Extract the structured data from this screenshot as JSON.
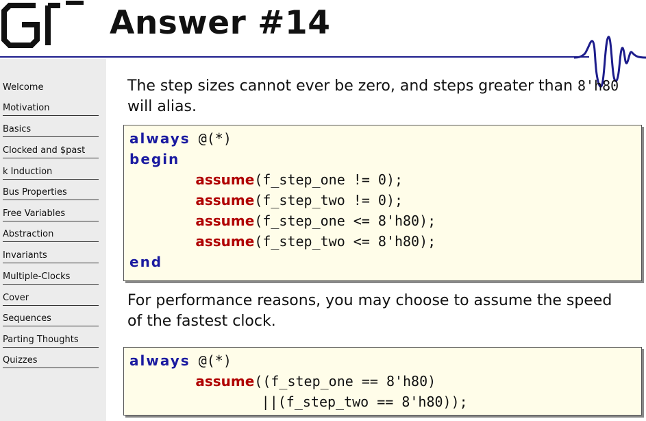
{
  "header": {
    "title": "Answer #14"
  },
  "sidebar": {
    "items": [
      {
        "label": "Welcome"
      },
      {
        "label": "Motivation"
      },
      {
        "label": "Basics"
      },
      {
        "label": "Clocked and $past"
      },
      {
        "label": "k Induction"
      },
      {
        "label": "Bus Properties"
      },
      {
        "label": "Free Variables"
      },
      {
        "label": "Abstraction"
      },
      {
        "label": "Invariants"
      },
      {
        "label": "Multiple-Clocks"
      },
      {
        "label": "Cover"
      },
      {
        "label": "Sequences"
      },
      {
        "label": "Parting Thoughts"
      },
      {
        "label": "Quizzes"
      }
    ]
  },
  "main": {
    "para1_text": "The step sizes cannot ever be zero, and steps greater than ",
    "para1_code": "8'h80",
    "para1_end": "will alias.",
    "block1": {
      "l1_kw": "always",
      "l1_rest": " @(*)",
      "l2_kw": "begin",
      "l3_fn": "assume",
      "l3_rest": "(f_step_one != 0);",
      "l4_fn": "assume",
      "l4_rest": "(f_step_two != 0);",
      "l5_fn": "assume",
      "l5_rest": "(f_step_one <= 8'h80);",
      "l6_fn": "assume",
      "l6_rest": "(f_step_two <= 8'h80);",
      "l7_kw": "end"
    },
    "para2_line1": "For performance reasons, you may choose to assume the speed",
    "para2_line2": "of the fastest clock.",
    "block2": {
      "l1_kw": "always",
      "l1_rest": " @(*)",
      "l2_fn": "assume",
      "l2_rest": "((f_step_one == 8'h80)",
      "l3_rest": "||(f_step_two == 8'h80));"
    }
  }
}
